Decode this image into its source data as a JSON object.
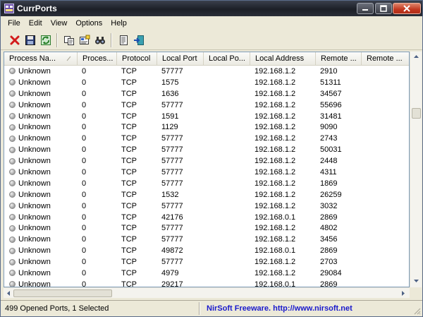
{
  "window": {
    "title": "CurrPorts"
  },
  "menu": [
    "File",
    "Edit",
    "View",
    "Options",
    "Help"
  ],
  "toolbar": [
    "close-connection-icon",
    "save-icon",
    "refresh-icon",
    "copy-icon",
    "properties-icon",
    "find-icon",
    "html-report-icon",
    "exit-icon"
  ],
  "columns": [
    "Process Na...",
    "Proces...",
    "Protocol",
    "Local Port",
    "Local Po...",
    "Local Address",
    "Remote ...",
    "Remote ..."
  ],
  "rows": [
    [
      "Unknown",
      "0",
      "TCP",
      "57777",
      "",
      "192.168.1.2",
      "2910",
      ""
    ],
    [
      "Unknown",
      "0",
      "TCP",
      "1575",
      "",
      "192.168.1.2",
      "51311",
      ""
    ],
    [
      "Unknown",
      "0",
      "TCP",
      "1636",
      "",
      "192.168.1.2",
      "34567",
      ""
    ],
    [
      "Unknown",
      "0",
      "TCP",
      "57777",
      "",
      "192.168.1.2",
      "55696",
      ""
    ],
    [
      "Unknown",
      "0",
      "TCP",
      "1591",
      "",
      "192.168.1.2",
      "31481",
      ""
    ],
    [
      "Unknown",
      "0",
      "TCP",
      "1129",
      "",
      "192.168.1.2",
      "9090",
      ""
    ],
    [
      "Unknown",
      "0",
      "TCP",
      "57777",
      "",
      "192.168.1.2",
      "2743",
      ""
    ],
    [
      "Unknown",
      "0",
      "TCP",
      "57777",
      "",
      "192.168.1.2",
      "50031",
      ""
    ],
    [
      "Unknown",
      "0",
      "TCP",
      "57777",
      "",
      "192.168.1.2",
      "2448",
      ""
    ],
    [
      "Unknown",
      "0",
      "TCP",
      "57777",
      "",
      "192.168.1.2",
      "4311",
      ""
    ],
    [
      "Unknown",
      "0",
      "TCP",
      "57777",
      "",
      "192.168.1.2",
      "1869",
      ""
    ],
    [
      "Unknown",
      "0",
      "TCP",
      "1532",
      "",
      "192.168.1.2",
      "26259",
      ""
    ],
    [
      "Unknown",
      "0",
      "TCP",
      "57777",
      "",
      "192.168.1.2",
      "3032",
      ""
    ],
    [
      "Unknown",
      "0",
      "TCP",
      "42176",
      "",
      "192.168.0.1",
      "2869",
      ""
    ],
    [
      "Unknown",
      "0",
      "TCP",
      "57777",
      "",
      "192.168.1.2",
      "4802",
      ""
    ],
    [
      "Unknown",
      "0",
      "TCP",
      "57777",
      "",
      "192.168.1.2",
      "3456",
      ""
    ],
    [
      "Unknown",
      "0",
      "TCP",
      "49872",
      "",
      "192.168.0.1",
      "2869",
      ""
    ],
    [
      "Unknown",
      "0",
      "TCP",
      "57777",
      "",
      "192.168.1.2",
      "2703",
      ""
    ],
    [
      "Unknown",
      "0",
      "TCP",
      "4979",
      "",
      "192.168.1.2",
      "29084",
      ""
    ],
    [
      "Unknown",
      "0",
      "TCP",
      "29217",
      "",
      "192.168.0.1",
      "2869",
      ""
    ]
  ],
  "status": {
    "left": "499 Opened Ports, 1 Selected",
    "right": "NirSoft Freeware.  http://www.nirsoft.net"
  }
}
